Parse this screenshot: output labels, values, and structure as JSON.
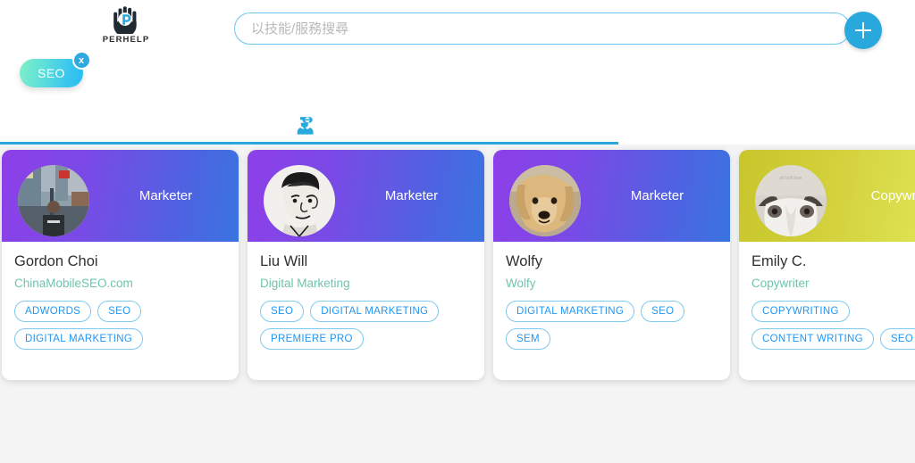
{
  "header": {
    "logo_text": "PERHELP",
    "logo_icon": "hand-p-logo-icon",
    "search": {
      "placeholder": "以技能/服務搜尋",
      "value": ""
    },
    "add_button_icon": "plus-icon"
  },
  "filters": {
    "chips": [
      {
        "label": "SEO",
        "close_label": "x"
      }
    ]
  },
  "tabs": [
    {
      "icon": "person-with-glasses-icon",
      "active": true
    }
  ],
  "colors": {
    "accent": "#29a8de",
    "tag_text": "#2196f3",
    "tag_border": "#7ec9ee",
    "subtitle": "#6ec5ad",
    "marketer_gradient_start": "#8d3fe8",
    "marketer_gradient_end": "#3a74e0",
    "copywriter_gradient_start": "#c8c62b",
    "copywriter_gradient_end": "#e5e860",
    "chip_gradient_start": "#7ff0c8",
    "chip_gradient_end": "#28bdf2",
    "page_background": "#f4f4f4"
  },
  "cards": [
    {
      "role": "Marketer",
      "theme": "marketer",
      "avatar": "street-photo-avatar",
      "name": "Gordon Choi",
      "subtitle": "ChinaMobileSEO.com",
      "tags": [
        "ADWORDS",
        "SEO",
        "DIGITAL MARKETING"
      ]
    },
    {
      "role": "Marketer",
      "theme": "marketer",
      "avatar": "line-art-portrait-avatar",
      "name": "Liu Will",
      "subtitle": "Digital Marketing",
      "tags": [
        "SEO",
        "DIGITAL MARKETING",
        "PREMIERE PRO"
      ]
    },
    {
      "role": "Marketer",
      "theme": "marketer",
      "avatar": "golden-retriever-avatar",
      "name": "Wolfy",
      "subtitle": "Wolfy",
      "tags": [
        "DIGITAL MARKETING",
        "SEO",
        "SEM"
      ]
    },
    {
      "role": "Copywriter",
      "theme": "copywriter",
      "avatar": "bulldog-avatar",
      "name": "Emily C.",
      "subtitle": "Copywriter",
      "tags": [
        "COPYWRITING",
        "CONTENT WRITING",
        "SEO"
      ]
    }
  ]
}
